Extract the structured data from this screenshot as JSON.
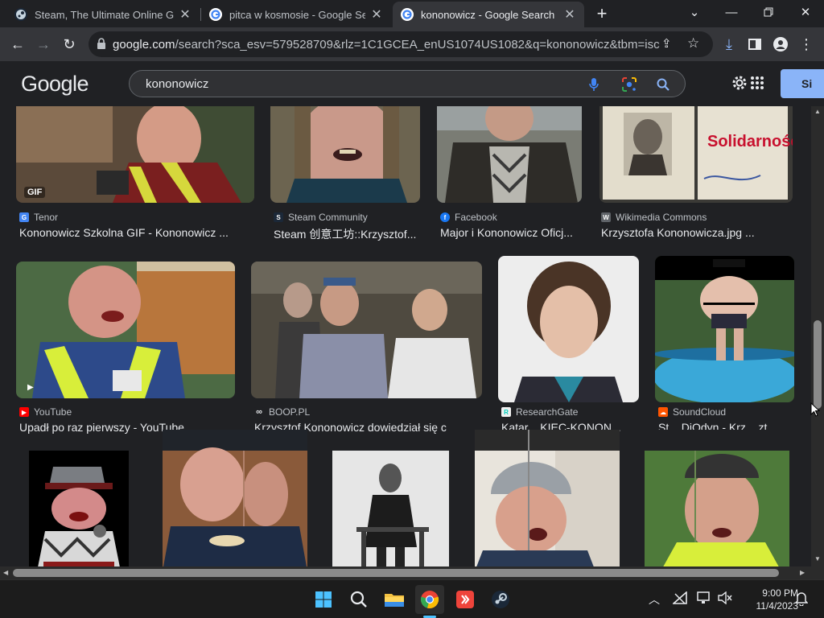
{
  "browser": {
    "tabs": [
      {
        "title": "Steam, The Ultimate Online Game Platform",
        "icon": "steam-icon",
        "active": false
      },
      {
        "title": "pitca w kosmosie - Google Search",
        "icon": "google-icon",
        "active": false
      },
      {
        "title": "kononowicz - Google Search",
        "icon": "google-icon",
        "active": true
      }
    ],
    "new_tab_label": "+",
    "url_domain": "google.com",
    "url_path": "/search?sca_esv=579528709&rlz=1C1GCEA_enUS1074US1082&q=kononowicz&tbm=isch&sou..."
  },
  "google": {
    "logo": "Google",
    "query": "kononowicz",
    "signin_label": "Si"
  },
  "results_row1": [
    {
      "source": "Tenor",
      "title": "Kononowicz Szkolna GIF - Kononowicz ...",
      "badge": "GIF",
      "icon_color": "#4285f4"
    },
    {
      "source": "Steam Community",
      "title": "Steam 创意工坊::Krzysztof...",
      "icon_color": "#1b2838"
    },
    {
      "source": "Facebook",
      "title": "Major i Kononowicz Oficj...",
      "icon_color": "#1877f2"
    },
    {
      "source": "Wikimedia Commons",
      "title": "Krzysztofa Kononowicza.jpg ...",
      "icon_color": "#5f6368"
    }
  ],
  "results_row2": [
    {
      "source": "YouTube",
      "title": "Upadł po raz pierwszy - YouTube",
      "icon_color": "#ff0000"
    },
    {
      "source": "BOOP.PL",
      "title": "Krzysztof Kononowicz dowiedział się c",
      "icon_color": "#202124"
    },
    {
      "source": "ResearchGate",
      "title": "Katar... KIEC-KONON...",
      "icon_color": "#00ccbb"
    },
    {
      "source": "SoundCloud",
      "title": "St... DjOdyn - Krz... zt.",
      "icon_color": "#ff5500"
    }
  ],
  "taskbar": {
    "time": "9:00 PM",
    "date": "11/4/2023"
  },
  "colors": {
    "background": "#202124",
    "toolbar": "#35363a",
    "accent": "#8ab4f8"
  }
}
